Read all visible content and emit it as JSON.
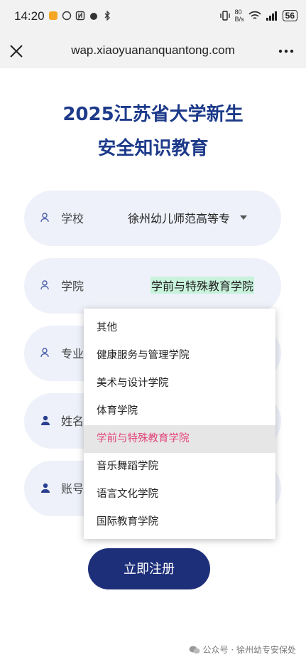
{
  "status_bar": {
    "time": "14:20",
    "net_speed_top": "80",
    "net_speed_unit": "B/s",
    "battery": "56"
  },
  "browser": {
    "url": "wap.xiaoyuananquantong.com"
  },
  "page": {
    "title_line1": "2025江苏省大学新生",
    "title_line2": "安全知识教育"
  },
  "form": {
    "school": {
      "label": "学校",
      "value": "徐州幼儿师范高等专"
    },
    "college": {
      "label": "学院",
      "value": "学前与特殊教育学院"
    },
    "major": {
      "label": "专业"
    },
    "name": {
      "label": "姓名"
    },
    "account": {
      "label": "账号"
    }
  },
  "dropdown": {
    "options": [
      "其他",
      "健康服务与管理学院",
      "美术与设计学院",
      "体育学院",
      "学前与特殊教育学院",
      "音乐舞蹈学院",
      "语言文化学院",
      "国际教育学院"
    ],
    "selected_index": 4,
    "selected_color": "#e2447a"
  },
  "register_button": {
    "label": "立即注册"
  },
  "watermark": {
    "text": "公众号 · 徐州幼专安保处"
  },
  "colors": {
    "title": "#1d3a8a",
    "button": "#1e2f7a",
    "pill_bg": "#eef1f9"
  }
}
